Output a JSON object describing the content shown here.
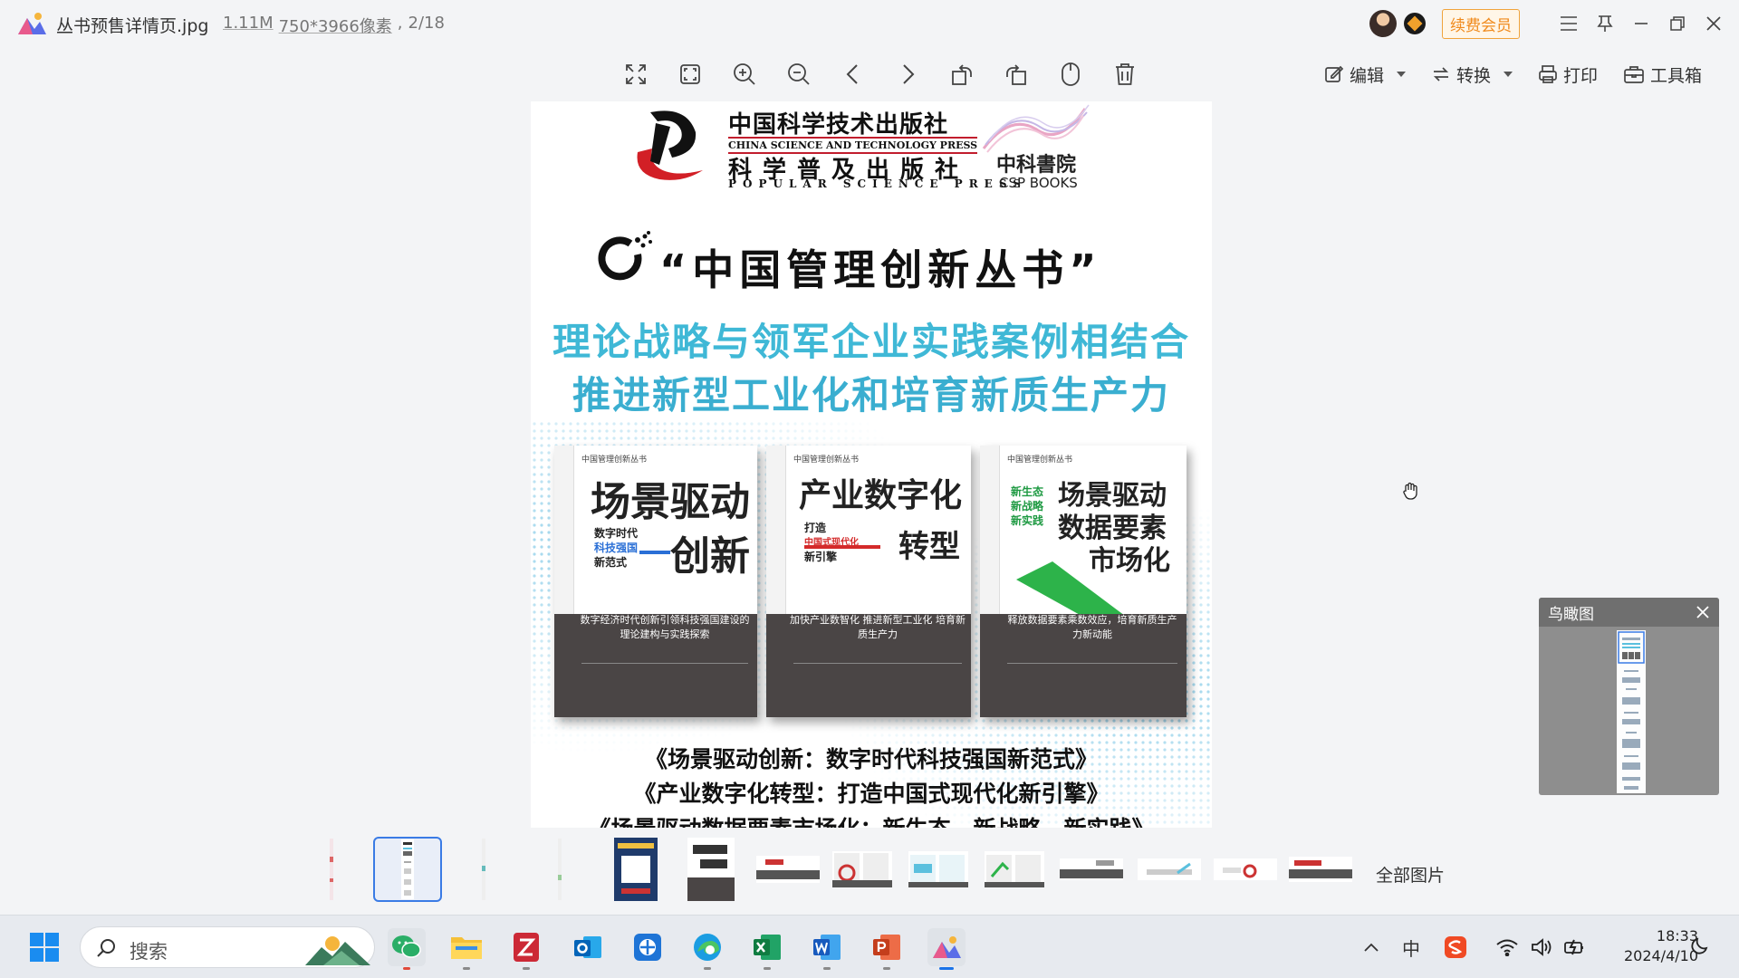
{
  "titlebar": {
    "file_name": "丛书预售详情页.jpg",
    "file_size": "1.11M",
    "file_dims": "750*3966像素",
    "page_index": "2/18",
    "vip_label": "续费会员"
  },
  "toolbar": {
    "icons": [
      "fullscreen-icon",
      "fit-window-icon",
      "zoom-in-icon",
      "zoom-out-icon",
      "prev-icon",
      "next-icon",
      "rotate-left-icon",
      "rotate-right-icon",
      "mouse-icon",
      "delete-icon"
    ],
    "edit_label": "编辑",
    "convert_label": "转换",
    "print_label": "打印",
    "toolbox_label": "工具箱"
  },
  "poster": {
    "publisher_cn": "中国科学技术出版社",
    "publisher_en": "CHINA SCIENCE AND TECHNOLOGY PRESS",
    "publisher2_cn": "科学普及出版社",
    "publisher2_en": "POPULAR SCIENCE PRESS",
    "csp_cn": "中科書院",
    "csp_en": "CSP BOOKS",
    "series_title": "“中国管理创新丛书”",
    "slogan_1": "理论战略与领军企业实践案例相结合",
    "slogan_2": "推进新型工业化和培育新质生产力",
    "books": [
      {
        "series_tag": "中国管理创新丛书",
        "title_a": "场景驱动",
        "title_b": "创新",
        "sub": [
          "数字时代",
          "科技强国",
          "新范式"
        ],
        "tagline": "数字经济时代创新引领科技强国建设的理论建构与实践探索"
      },
      {
        "series_tag": "中国管理创新丛书",
        "title_a": "产业数字化",
        "title_b": "转型",
        "sub": [
          "打造",
          "中国式现代化",
          "新引擎"
        ],
        "tagline": "加快产业数智化 推进新型工业化 培育新质生产力"
      },
      {
        "series_tag": "中国管理创新丛书",
        "title_a": "场景驱动",
        "title_b": "数据要素",
        "title_c": "市场化",
        "sub": [
          "新生态",
          "新战略",
          "新实践"
        ],
        "tagline": "释放数据要素乘数效应，培育新质生产力新动能"
      }
    ],
    "book_line_1": "《场景驱动创新：数字时代科技强国新范式》",
    "book_line_2": "《产业数字化转型：打造中国式现代化新引擎》",
    "book_line_3": "《场景驱动数据要素市场化：新生态、新战略、新实践》"
  },
  "birdseye": {
    "title": "鸟瞰图"
  },
  "filmstrip": {
    "all_images_label": "全部图片",
    "selected_index": 1,
    "count": 14
  },
  "taskbar": {
    "search_placeholder": "搜索",
    "ime_label": "中",
    "time": "18:33",
    "date": "2024/4/10"
  }
}
